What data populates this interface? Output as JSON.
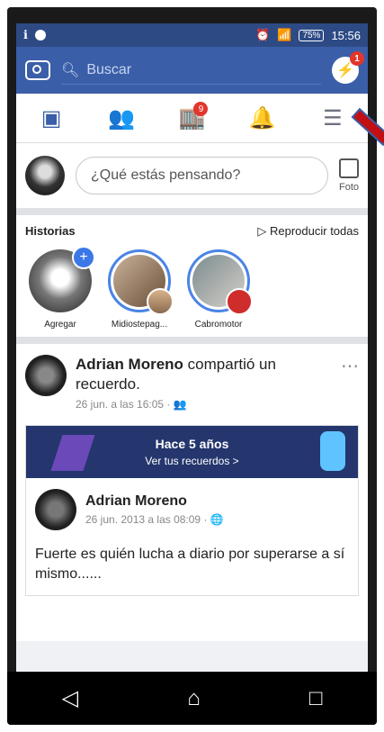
{
  "statusbar": {
    "left_icons": [
      "voicemail-icon",
      "messenger-notif-icon"
    ],
    "battery": "75%",
    "time": "15:56"
  },
  "topbar": {
    "search_placeholder": "Buscar",
    "messenger_badge": "1"
  },
  "nav": {
    "requests_badge": "9"
  },
  "composer": {
    "placeholder": "¿Qué estás pensando?",
    "photo_label": "Foto"
  },
  "stories": {
    "title": "Historias",
    "play_all": "Reproducir todas",
    "items": [
      {
        "name": "Agregar"
      },
      {
        "name": "Midiostepag..."
      },
      {
        "name": "Cabromotor"
      }
    ]
  },
  "post": {
    "author": "Adrian Moreno",
    "action": " compartió un recuerdo.",
    "meta": "26 jun. a las 16:05 · 👥",
    "memory": {
      "title": "Hace 5 años",
      "subtitle": "Ver tus recuerdos >"
    },
    "inner": {
      "author": "Adrian Moreno",
      "meta": "26 jun. 2013 a las 08:09 · 🌐",
      "text": "Fuerte es quién lucha a diario por superarse a sí mismo......"
    }
  }
}
